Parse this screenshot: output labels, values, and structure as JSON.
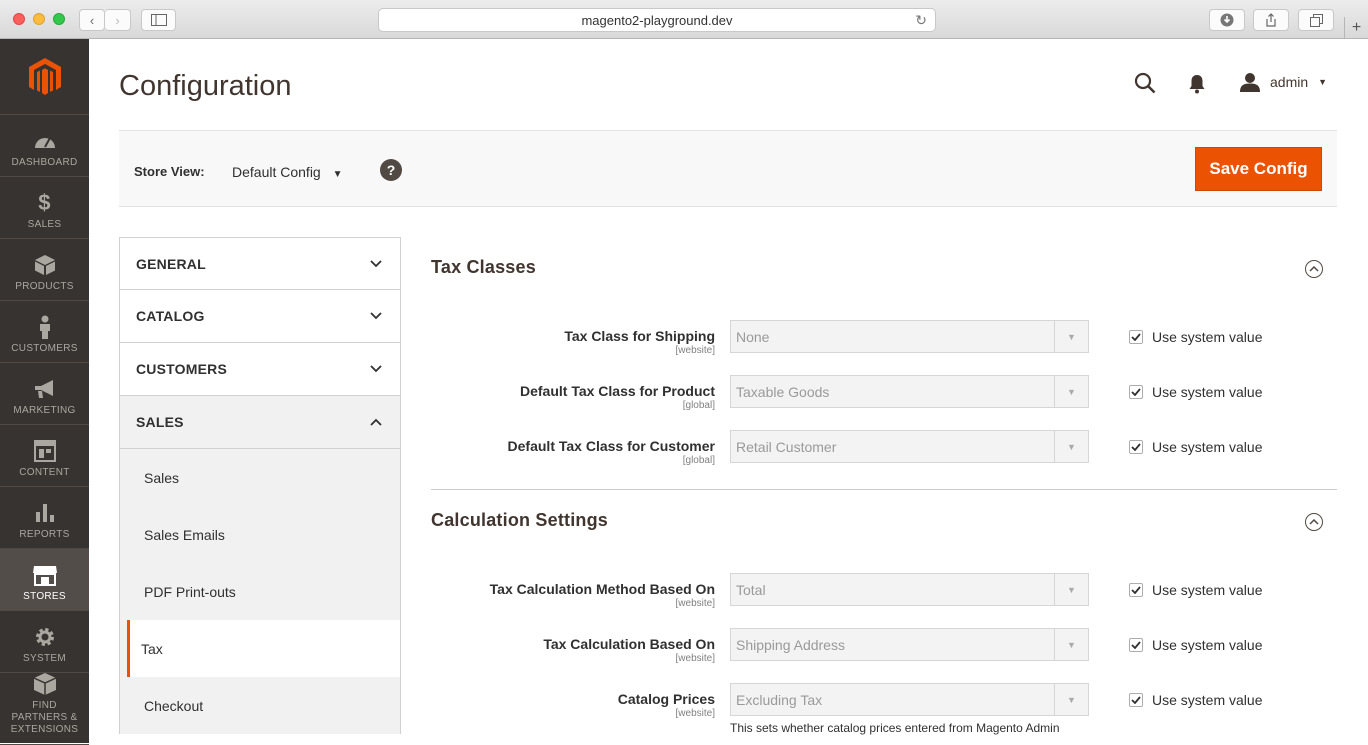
{
  "browser": {
    "url": "magento2-playground.dev"
  },
  "nav": {
    "items": [
      {
        "label": "DASHBOARD"
      },
      {
        "label": "SALES"
      },
      {
        "label": "PRODUCTS"
      },
      {
        "label": "CUSTOMERS"
      },
      {
        "label": "MARKETING"
      },
      {
        "label": "CONTENT"
      },
      {
        "label": "REPORTS"
      },
      {
        "label": "STORES"
      },
      {
        "label": "SYSTEM"
      },
      {
        "label": "FIND PARTNERS & EXTENSIONS"
      }
    ],
    "active": "STORES",
    "colors": {
      "bg": "#373330",
      "active_bg": "#524d49",
      "logo": "#eb5202"
    }
  },
  "header": {
    "title": "Configuration",
    "user": "admin"
  },
  "store_bar": {
    "label": "Store View:",
    "selected": "Default Config",
    "help": "?",
    "save_label": "Save Config",
    "accent": "#eb5202"
  },
  "tabs": {
    "groups": [
      {
        "label": "GENERAL"
      },
      {
        "label": "CATALOG"
      },
      {
        "label": "CUSTOMERS"
      },
      {
        "label": "SALES"
      }
    ],
    "sales_items": [
      {
        "label": "Sales"
      },
      {
        "label": "Sales Emails"
      },
      {
        "label": "PDF Print-outs"
      },
      {
        "label": "Tax"
      },
      {
        "label": "Checkout"
      }
    ],
    "active_item": "Tax"
  },
  "sections": {
    "tax_classes": {
      "title": "Tax Classes",
      "rows": [
        {
          "label": "Tax Class for Shipping",
          "scope": "[website]",
          "value": "None",
          "checkbox": "Use system value"
        },
        {
          "label": "Default Tax Class for Product",
          "scope": "[global]",
          "value": "Taxable Goods",
          "checkbox": "Use system value"
        },
        {
          "label": "Default Tax Class for Customer",
          "scope": "[global]",
          "value": "Retail Customer",
          "checkbox": "Use system value"
        }
      ]
    },
    "calculation": {
      "title": "Calculation Settings",
      "rows": [
        {
          "label": "Tax Calculation Method Based On",
          "scope": "[website]",
          "value": "Total",
          "checkbox": "Use system value"
        },
        {
          "label": "Tax Calculation Based On",
          "scope": "[website]",
          "value": "Shipping Address",
          "checkbox": "Use system value"
        },
        {
          "label": "Catalog Prices",
          "scope": "[website]",
          "value": "Excluding Tax",
          "checkbox": "Use system value"
        }
      ],
      "note": "This sets whether catalog prices entered from Magento Admin"
    }
  }
}
